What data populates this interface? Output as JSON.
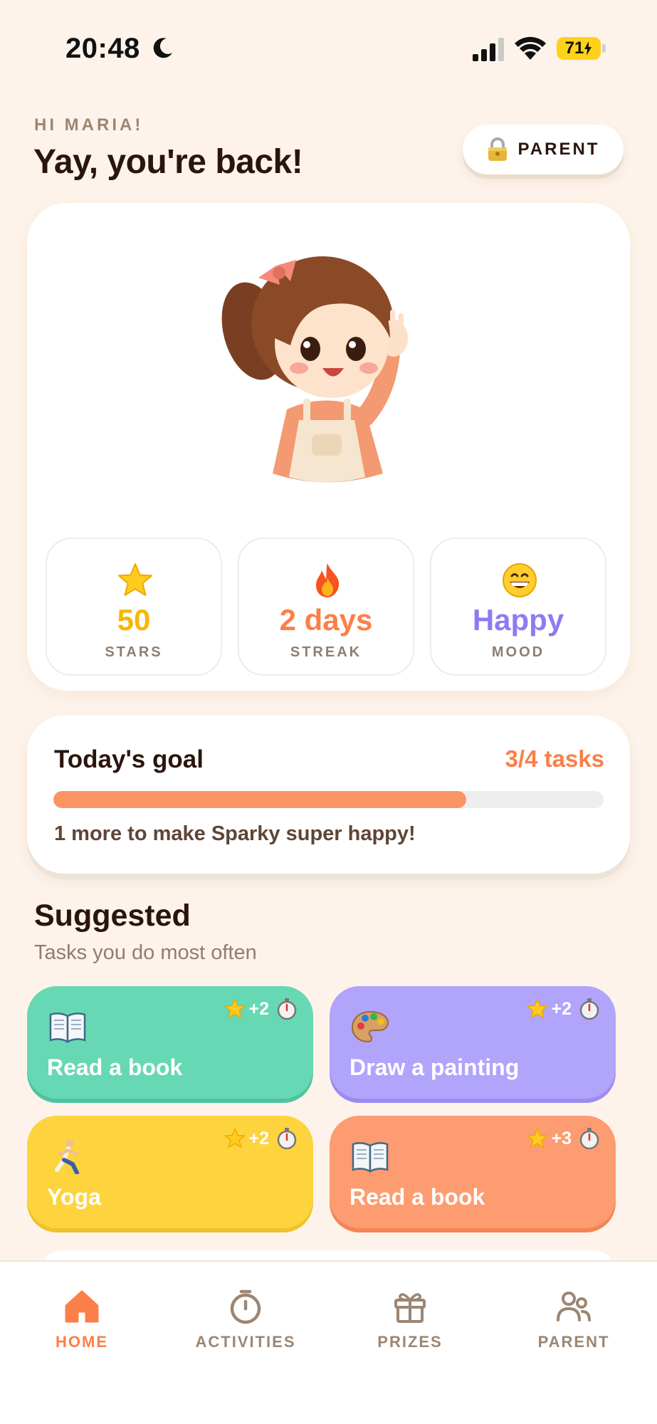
{
  "status_bar": {
    "time": "20:48",
    "battery": "71",
    "icons": [
      "moon-icon",
      "signal-icon",
      "wifi-icon",
      "battery-icon"
    ]
  },
  "header": {
    "greeting": "HI MARIA!",
    "title": "Yay, you're back!",
    "parent_button": "PARENT",
    "parent_button_icon": "lock-icon"
  },
  "hero": {
    "mascot": "girl-mascot-waving",
    "stats": [
      {
        "icon": "star-icon",
        "value": "50",
        "label": "STARS",
        "color": "#f7b600"
      },
      {
        "icon": "fire-icon",
        "value": "2 days",
        "label": "STREAK",
        "color": "#fb7f48"
      },
      {
        "icon": "grinning-face-icon",
        "value": "Happy",
        "label": "MOOD",
        "color": "#8d7bf2"
      }
    ]
  },
  "goal": {
    "title": "Today's goal",
    "count": "3/4 tasks",
    "progress": 0.75,
    "message": "1 more to make Sparky super happy!"
  },
  "suggested": {
    "title": "Suggested",
    "subtitle": "Tasks you do most often",
    "tasks": [
      {
        "name": "Read a book",
        "points": "+2",
        "icon": "open-book-icon",
        "color": "#66d8b4"
      },
      {
        "name": "Draw a painting",
        "points": "+2",
        "icon": "palette-icon",
        "color": "#b0a4fb"
      },
      {
        "name": "Yoga",
        "points": "+2",
        "icon": "running-person-icon",
        "color": "#fdd43e"
      },
      {
        "name": "Read a book",
        "points": "+3",
        "icon": "open-book-icon",
        "color": "#fc9c70"
      }
    ]
  },
  "tab_bar": {
    "active_color": "#fb7f48",
    "inactive_color": "#9c8672",
    "tabs": [
      {
        "label": "HOME",
        "icon": "home-icon",
        "active": true
      },
      {
        "label": "ACTIVITIES",
        "icon": "stopwatch-icon",
        "active": false
      },
      {
        "label": "PRIZES",
        "icon": "gift-icon",
        "active": false
      },
      {
        "label": "PARENT",
        "icon": "people-icon",
        "active": false
      }
    ]
  }
}
